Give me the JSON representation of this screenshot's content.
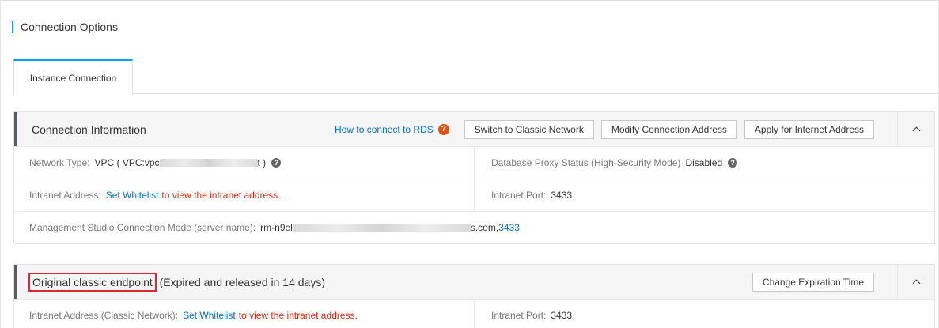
{
  "section": {
    "title": "Connection Options"
  },
  "tabs": [
    {
      "label": "Instance Connection"
    }
  ],
  "connection_panel": {
    "title": "Connection Information",
    "help_link": "How to connect to RDS",
    "help_badge": "?",
    "buttons": {
      "switch_classic": "Switch to Classic Network",
      "modify_address": "Modify Connection Address",
      "apply_internet": "Apply for Internet Address"
    },
    "network_type": {
      "label": "Network Type:",
      "value_prefix": "VPC  ( VPC:vpc",
      "value_suffix": "t )"
    },
    "proxy_status": {
      "label": "Database Proxy Status (High-Security Mode)",
      "value": "Disabled"
    },
    "intranet_address": {
      "label": "Intranet Address:",
      "link": "Set Whitelist",
      "note": "to view the intranet address."
    },
    "intranet_port": {
      "label": "Intranet Port:",
      "value": "3433"
    },
    "mgmt_studio": {
      "label": "Management Studio Connection Mode (server name):",
      "value_prefix": "rm-n9el",
      "value_suffix": "s.com,",
      "port": "3433"
    }
  },
  "classic_panel": {
    "title": "Original classic endpoint",
    "subtitle": "(Expired and released in 14 days)",
    "button": "Change Expiration Time",
    "intranet_address": {
      "label": "Intranet Address (Classic Network):",
      "link": "Set Whitelist",
      "note": "to view the intranet address."
    },
    "intranet_port": {
      "label": "Intranet Port:",
      "value": "3433"
    }
  },
  "colors": {
    "accent": "#00a2ff",
    "link": "#0070cc",
    "warning": "#e8260b",
    "highlight": "#e0262d"
  },
  "icons": {
    "help": "question-circle-icon",
    "collapse": "chevron-up-icon"
  }
}
